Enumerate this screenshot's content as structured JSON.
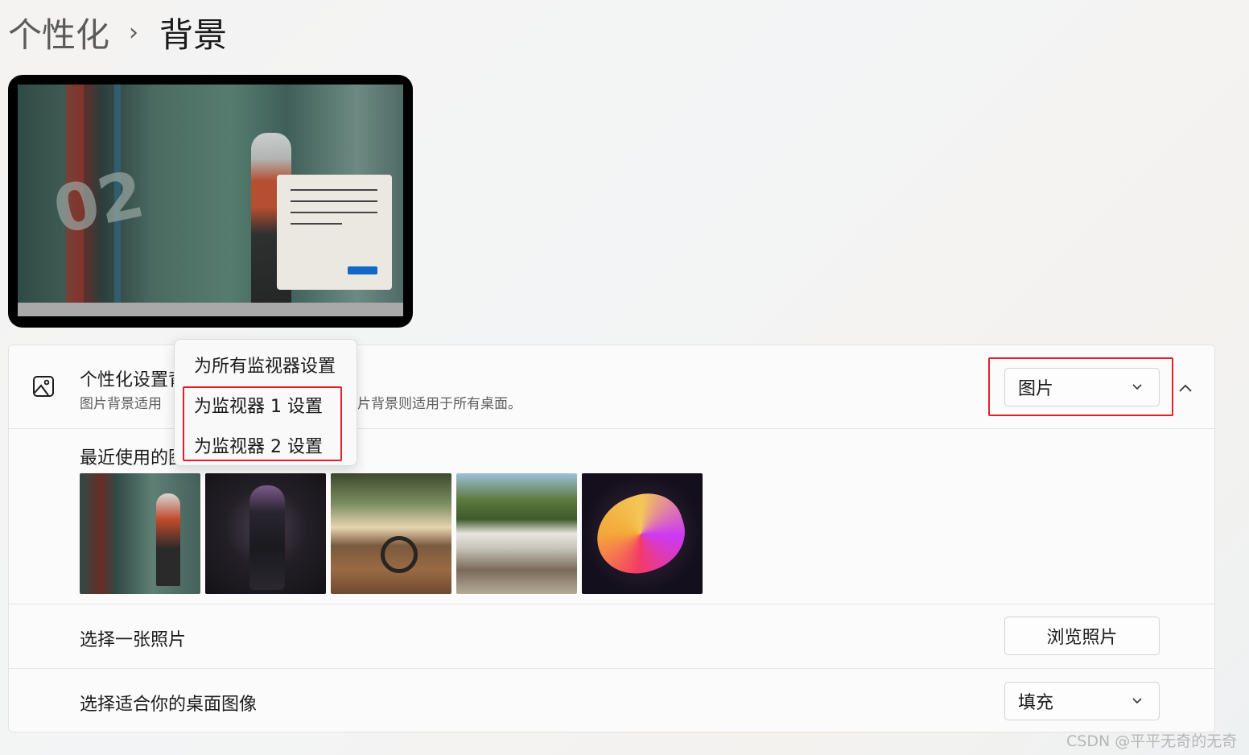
{
  "breadcrumb": {
    "parent": "个性化",
    "separator": "›",
    "current": "背景"
  },
  "background_row": {
    "title": "个性化设置背",
    "subtitle_left": "图片背景适用",
    "subtitle_right": "片背景则适用于所有桌面。",
    "dropdown_value": "图片",
    "icon": "image-icon"
  },
  "recent_row": {
    "title": "最近使用的图",
    "thumbnails": [
      "thumbnail-1",
      "thumbnail-2",
      "thumbnail-3",
      "thumbnail-4",
      "thumbnail-5"
    ]
  },
  "choose_photo_row": {
    "title": "选择一张照片",
    "button": "浏览照片"
  },
  "fit_row": {
    "title": "选择适合你的桌面图像",
    "dropdown_value": "填充"
  },
  "context_menu": {
    "items": [
      "为所有监视器设置",
      "为监视器 1 设置",
      "为监视器 2 设置"
    ]
  },
  "highlight_color": "#e0212d",
  "watermark": "CSDN @平平无奇的无奇"
}
